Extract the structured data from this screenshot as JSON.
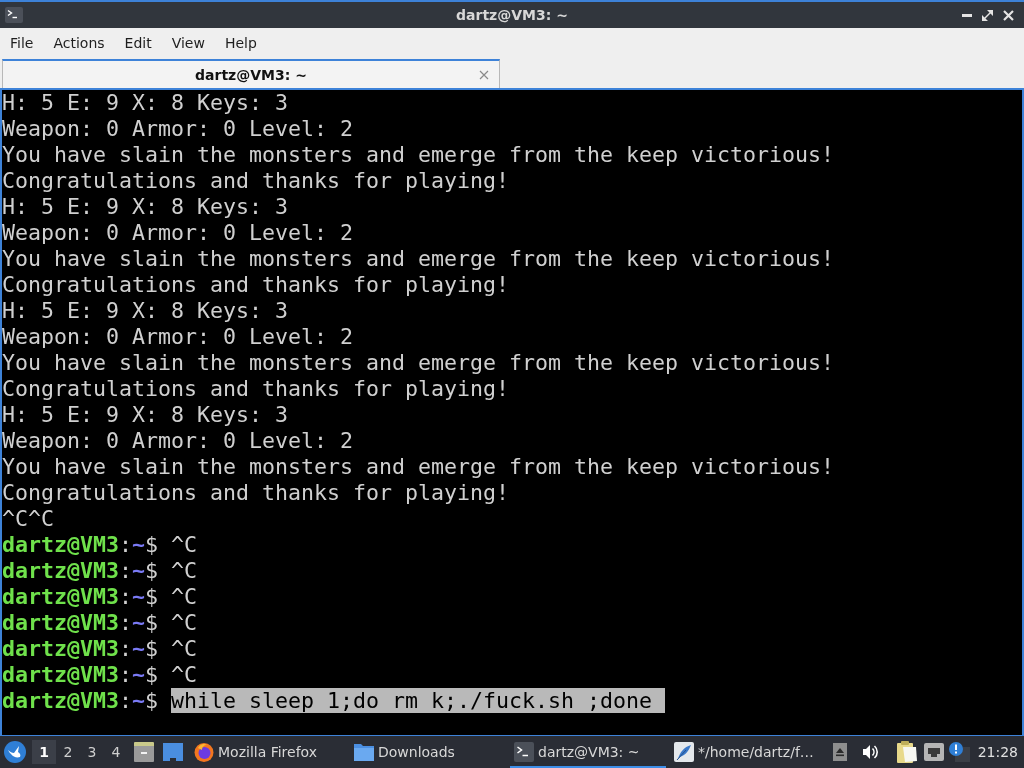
{
  "window": {
    "title": "dartz@VM3: ~"
  },
  "menu": [
    "File",
    "Actions",
    "Edit",
    "View",
    "Help"
  ],
  "tabs": [
    {
      "label": "dartz@VM3: ~",
      "selected": true
    }
  ],
  "terminal": {
    "lines": [
      {
        "kind": "output",
        "text": "H: 5 E: 9 X: 8 Keys: 3",
        "selected": false
      },
      {
        "kind": "output",
        "text": "Weapon: 0 Armor: 0 Level: 2",
        "selected": false
      },
      {
        "kind": "output",
        "text": "You have slain the monsters and emerge from the keep victorious!",
        "selected": false
      },
      {
        "kind": "output",
        "text": "Congratulations and thanks for playing!",
        "selected": false
      },
      {
        "kind": "output",
        "text": "H: 5 E: 9 X: 8 Keys: 3",
        "selected": false
      },
      {
        "kind": "output",
        "text": "Weapon: 0 Armor: 0 Level: 2",
        "selected": false
      },
      {
        "kind": "output",
        "text": "You have slain the monsters and emerge from the keep victorious!",
        "selected": false
      },
      {
        "kind": "output",
        "text": "Congratulations and thanks for playing!",
        "selected": false
      },
      {
        "kind": "output",
        "text": "H: 5 E: 9 X: 8 Keys: 3",
        "selected": false
      },
      {
        "kind": "output",
        "text": "Weapon: 0 Armor: 0 Level: 2",
        "selected": false
      },
      {
        "kind": "output",
        "text": "You have slain the monsters and emerge from the keep victorious!",
        "selected": false
      },
      {
        "kind": "output",
        "text": "Congratulations and thanks for playing!",
        "selected": false
      },
      {
        "kind": "output",
        "text": "H: 5 E: 9 X: 8 Keys: 3",
        "selected": false
      },
      {
        "kind": "output",
        "text": "Weapon: 0 Armor: 0 Level: 2",
        "selected": false
      },
      {
        "kind": "output",
        "text": "You have slain the monsters and emerge from the keep victorious!",
        "selected": false
      },
      {
        "kind": "output",
        "text": "Congratulations and thanks for playing!",
        "selected": false
      },
      {
        "kind": "output",
        "text": "^C^C",
        "selected": false
      },
      {
        "kind": "prompt",
        "host": "dartz@VM3",
        "separator": ":",
        "path": "~",
        "symbol": "$",
        "command": "^C",
        "selected": false
      },
      {
        "kind": "prompt",
        "host": "dartz@VM3",
        "separator": ":",
        "path": "~",
        "symbol": "$",
        "command": "^C",
        "selected": false
      },
      {
        "kind": "prompt",
        "host": "dartz@VM3",
        "separator": ":",
        "path": "~",
        "symbol": "$",
        "command": "^C",
        "selected": false
      },
      {
        "kind": "prompt",
        "host": "dartz@VM3",
        "separator": ":",
        "path": "~",
        "symbol": "$",
        "command": "^C",
        "selected": false
      },
      {
        "kind": "prompt",
        "host": "dartz@VM3",
        "separator": ":",
        "path": "~",
        "symbol": "$",
        "command": "^C",
        "selected": false
      },
      {
        "kind": "prompt",
        "host": "dartz@VM3",
        "separator": ":",
        "path": "~",
        "symbol": "$",
        "command": "^C",
        "selected": false
      },
      {
        "kind": "prompt",
        "host": "dartz@VM3",
        "separator": ":",
        "path": "~",
        "symbol": "$",
        "command": "while sleep 1;do rm k;./fuck.sh ;done",
        "selected": true
      }
    ]
  },
  "taskbar": {
    "desktops": [
      {
        "label": "1",
        "selected": true
      },
      {
        "label": "2",
        "selected": false
      },
      {
        "label": "3",
        "selected": false
      },
      {
        "label": "4",
        "selected": false
      }
    ],
    "tasks": [
      {
        "kind": "browser",
        "label": "Mozilla Firefox",
        "selected": false
      },
      {
        "kind": "folder",
        "label": "Downloads",
        "selected": false
      },
      {
        "kind": "terminal",
        "label": "dartz@VM3: ~",
        "selected": true
      },
      {
        "kind": "editor",
        "label": "*/home/dartz/f…",
        "selected": false
      }
    ],
    "clock": "21:28"
  }
}
